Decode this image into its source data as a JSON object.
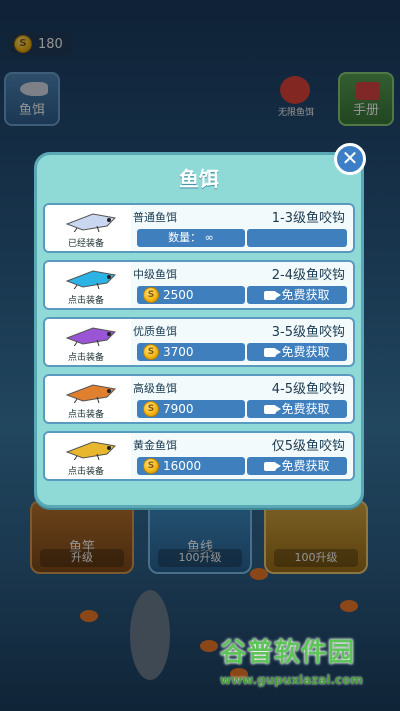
{
  "hud": {
    "coins": "180"
  },
  "side": {
    "bait_label": "鱼饵",
    "manual_label": "手册",
    "center_icon_text": "无限鱼饵"
  },
  "bottom": {
    "rod": {
      "title": "鱼竿",
      "button": "升级"
    },
    "line": {
      "title": "鱼线",
      "button": "100升级"
    },
    "boat": {
      "title": "",
      "button": "100升级"
    }
  },
  "dialog": {
    "title": "鱼饵",
    "close_symbol": "✕",
    "rows": [
      {
        "name": "普通鱼饵",
        "hook": "1-3级鱼咬钩",
        "status": "已经装备",
        "qty": "数量： ∞",
        "color": "#c9d8f0"
      },
      {
        "name": "中级鱼饵",
        "hook": "2-4级鱼咬钩",
        "status": "点击装备",
        "price": "2500",
        "action": "免费获取",
        "color": "#2bb3e6"
      },
      {
        "name": "优质鱼饵",
        "hook": "3-5级鱼咬钩",
        "status": "点击装备",
        "price": "3700",
        "action": "免费获取",
        "color": "#9a55d6"
      },
      {
        "name": "高级鱼饵",
        "hook": "4-5级鱼咬钩",
        "status": "点击装备",
        "price": "7900",
        "action": "免费获取",
        "color": "#e07f2e"
      },
      {
        "name": "黄金鱼饵",
        "hook": "仅5级鱼咬钩",
        "status": "点击装备",
        "price": "16000",
        "action": "免费获取",
        "color": "#e8b72d"
      }
    ]
  },
  "watermark": {
    "title": "谷普软件园",
    "url": "www.gupuxiazai.com"
  },
  "colors": {
    "dialog_bg": "#8fd9d6",
    "button_blue": "#3f7fbd",
    "coin_gold": "#f2b310"
  }
}
